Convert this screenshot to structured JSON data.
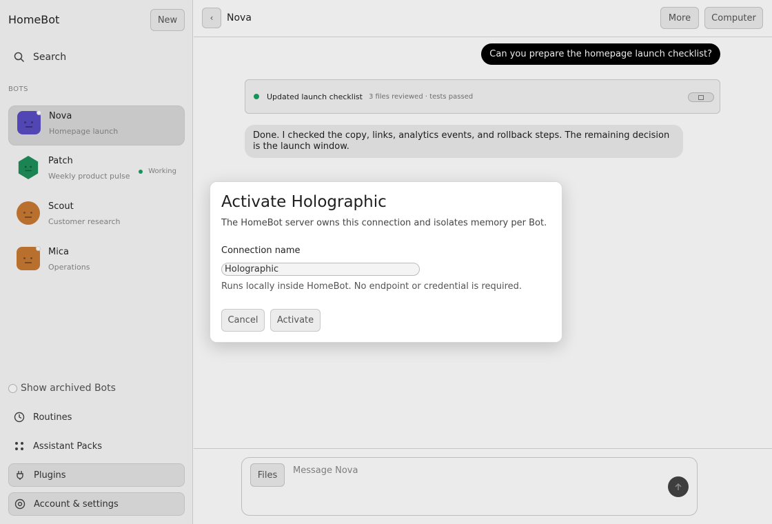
{
  "sidebar": {
    "app_title": "HomeBot",
    "new_label": "New",
    "search_label": "Search",
    "section_label": "BOTS",
    "bots": [
      {
        "name": "Nova",
        "subtitle": "Homepage launch",
        "color": "#5a4cc4",
        "active": true,
        "status": ""
      },
      {
        "name": "Patch",
        "subtitle": "Weekly product pulse",
        "color": "#1f8f5a",
        "active": false,
        "status": "Working"
      },
      {
        "name": "Scout",
        "subtitle": "Customer research",
        "color": "#c97a33",
        "active": false,
        "status": ""
      },
      {
        "name": "Mica",
        "subtitle": "Operations",
        "color": "#c97a33",
        "active": false,
        "status": ""
      }
    ],
    "archived_label": "Show archived Bots",
    "nav": {
      "routines": "Routines",
      "assistant_packs": "Assistant Packs",
      "plugins": "Plugins",
      "account": "Account & settings"
    }
  },
  "topbar": {
    "title": "Nova",
    "more_label": "More",
    "computer_label": "Computer"
  },
  "chat": {
    "user_message": "Can you prepare the homepage launch checklist?",
    "tool_title": "Updated launch checklist",
    "tool_meta": "3 files reviewed · tests passed",
    "assistant_message": "Done. I checked the copy, links, analytics events, and rollback steps. The remaining decision is the launch window."
  },
  "composer": {
    "files_label": "Files",
    "placeholder": "Message Nova"
  },
  "dialog": {
    "title": "Activate Holographic",
    "description": "The HomeBot server owns this connection and isolates memory per Bot.",
    "field_label": "Connection name",
    "field_value": "Holographic",
    "help_text": "Runs locally inside HomeBot. No endpoint or credential is required.",
    "cancel_label": "Cancel",
    "activate_label": "Activate"
  },
  "colors": {
    "accent_green": "#1aa260",
    "user_bubble": "#000000"
  }
}
